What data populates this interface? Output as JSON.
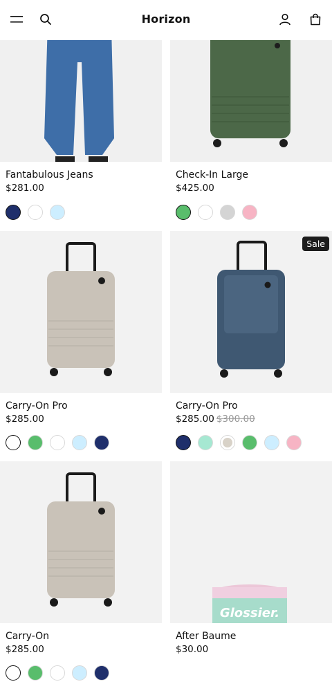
{
  "header": {
    "brand": "Horizon"
  },
  "products": [
    {
      "title": "Fantabulous Jeans",
      "price": "$281.00",
      "swatches": [
        "#1f2f6b",
        "#ffffff",
        "#cdeeff"
      ],
      "selected": 0
    },
    {
      "title": "Check-In Large",
      "price": "$425.00",
      "swatches": [
        "#59bd6c",
        "#ffffff",
        "#d4d4d4",
        "#f7b4c4"
      ],
      "selected": 0
    },
    {
      "title": "Carry-On Pro",
      "price": "$285.00",
      "swatches": [
        "#d8d2c8",
        "#59bd6c",
        "#ffffff",
        "#cdeeff",
        "#1f2f6b"
      ],
      "selected": 0
    },
    {
      "title": "Carry-On Pro",
      "price": "$285.00",
      "compare_price": "$300.00",
      "badge": "Sale",
      "swatches": [
        "#1f2f6b",
        "#a6e8d2",
        "#d8d2c8",
        "#59bd6c",
        "#cdeeff",
        "#f7b4c4"
      ],
      "selected": 0
    },
    {
      "title": "Carry-On",
      "price": "$285.00",
      "swatches": [
        "#d8d2c8",
        "#59bd6c",
        "#ffffff",
        "#cdeeff",
        "#1f2f6b"
      ],
      "selected": 0
    },
    {
      "title": "After Baume",
      "price": "$30.00",
      "swatches": [],
      "image_text": "Glossier."
    }
  ]
}
